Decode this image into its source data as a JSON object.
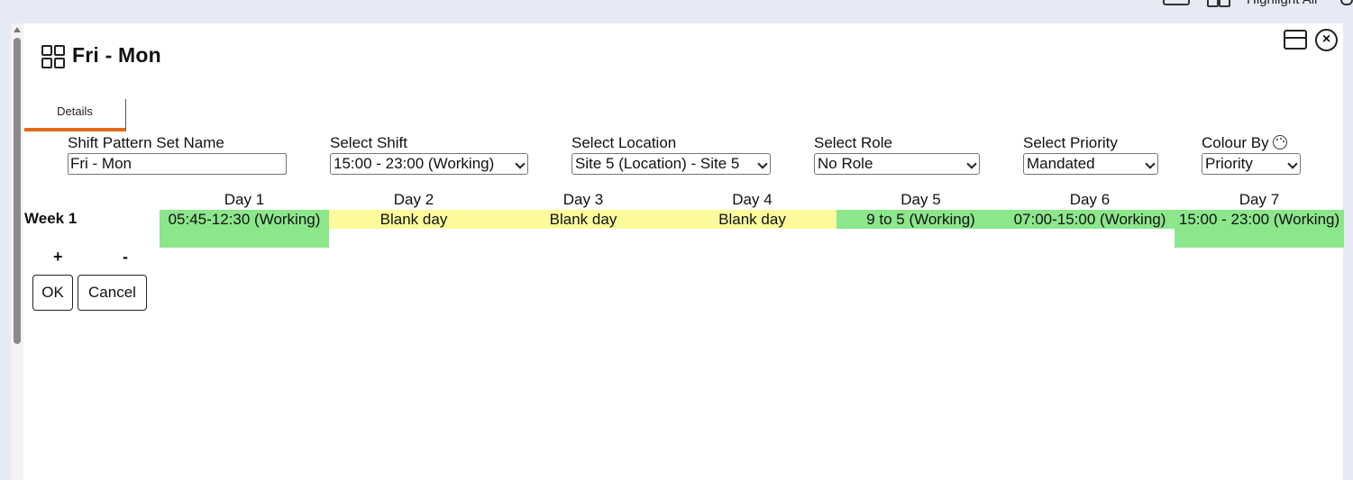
{
  "toolbar": {
    "highlight_label": "Highlight All"
  },
  "dialog": {
    "title": "Fri - Mon",
    "tabs": [
      {
        "label": "Details"
      }
    ]
  },
  "form": {
    "name_label": "Shift Pattern Set Name",
    "name_value": "Fri - Mon",
    "shift_label": "Select Shift",
    "shift_value": "15:00 - 23:00 (Working)",
    "location_label": "Select Location",
    "location_value": "Site 5 (Location) - Site 5",
    "role_label": "Select Role",
    "role_value": "No Role",
    "priority_label": "Select Priority",
    "priority_value": "Mandated",
    "colour_label": "Colour By",
    "colour_value": "Priority"
  },
  "grid": {
    "days": [
      "Day 1",
      "Day 2",
      "Day 3",
      "Day 4",
      "Day 5",
      "Day 6",
      "Day 7"
    ],
    "weeks": [
      {
        "label": "Week 1",
        "cells": [
          {
            "text": "05:45-12:30 (Working)",
            "color": "#8ce68c"
          },
          {
            "text": "Blank day",
            "color": "#fbfb9c"
          },
          {
            "text": "Blank day",
            "color": "#fbfb9c"
          },
          {
            "text": "Blank day",
            "color": "#fbfb9c"
          },
          {
            "text": "9 to 5 (Working)",
            "color": "#8ce68c"
          },
          {
            "text": "07:00-15:00 (Working)",
            "color": "#8ce68c"
          },
          {
            "text": "15:00 - 23:00 (Working)",
            "color": "#8ce68c"
          }
        ]
      }
    ],
    "add_week": "+",
    "remove_week": "-"
  },
  "buttons": {
    "ok": "OK",
    "cancel": "Cancel"
  },
  "colors": {
    "accent": "#e26a1a",
    "working": "#8ce68c",
    "blank": "#fbfb9c"
  }
}
